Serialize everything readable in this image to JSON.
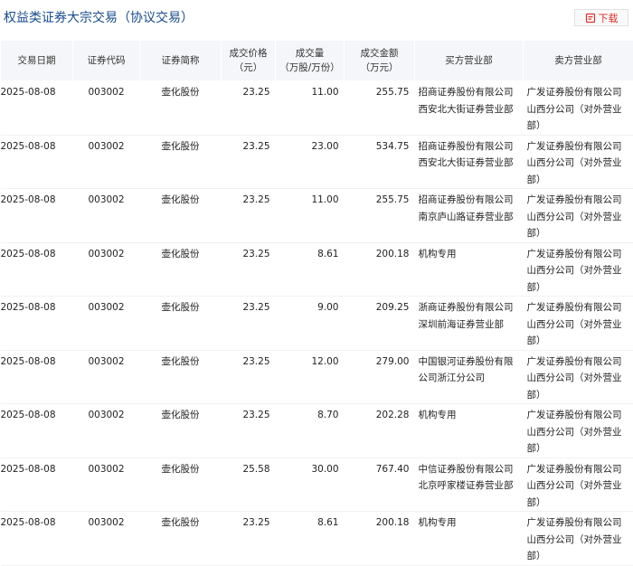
{
  "page": {
    "title": "权益类证券大宗交易（协议交易）",
    "download_label": "下载",
    "accent_color": "#d9302b",
    "title_color": "#1a4b8c"
  },
  "table": {
    "headers": {
      "date": "交易日期",
      "code": "证券代码",
      "name": "证券简称",
      "price": "成交价格\n（元）",
      "volume": "成交量\n（万股/万份）",
      "amount": "成交金额\n（万元）",
      "buyer": "买方营业部",
      "seller": "卖方营业部"
    },
    "rows": [
      {
        "date": "2025-08-08",
        "code": "003002",
        "name": "壶化股份",
        "price": "23.25",
        "volume": "11.00",
        "amount": "255.75",
        "buyer": "招商证券股份有限公司西安北大街证券营业部",
        "seller": "广发证券股份有限公司山西分公司（对外营业部）"
      },
      {
        "date": "2025-08-08",
        "code": "003002",
        "name": "壶化股份",
        "price": "23.25",
        "volume": "23.00",
        "amount": "534.75",
        "buyer": "招商证券股份有限公司西安北大街证券营业部",
        "seller": "广发证券股份有限公司山西分公司（对外营业部）"
      },
      {
        "date": "2025-08-08",
        "code": "003002",
        "name": "壶化股份",
        "price": "23.25",
        "volume": "11.00",
        "amount": "255.75",
        "buyer": "招商证券股份有限公司南京庐山路证券营业部",
        "seller": "广发证券股份有限公司山西分公司（对外营业部）"
      },
      {
        "date": "2025-08-08",
        "code": "003002",
        "name": "壶化股份",
        "price": "23.25",
        "volume": "8.61",
        "amount": "200.18",
        "buyer": "机构专用",
        "seller": "广发证券股份有限公司山西分公司（对外营业部）"
      },
      {
        "date": "2025-08-08",
        "code": "003002",
        "name": "壶化股份",
        "price": "23.25",
        "volume": "9.00",
        "amount": "209.25",
        "buyer": "浙商证券股份有限公司深圳前海证券营业部",
        "seller": "广发证券股份有限公司山西分公司（对外营业部）"
      },
      {
        "date": "2025-08-08",
        "code": "003002",
        "name": "壶化股份",
        "price": "23.25",
        "volume": "12.00",
        "amount": "279.00",
        "buyer": "中国银河证券股份有限公司浙江分公司",
        "seller": "广发证券股份有限公司山西分公司（对外营业部）"
      },
      {
        "date": "2025-08-08",
        "code": "003002",
        "name": "壶化股份",
        "price": "23.25",
        "volume": "8.70",
        "amount": "202.28",
        "buyer": "机构专用",
        "seller": "广发证券股份有限公司山西分公司（对外营业部）"
      },
      {
        "date": "2025-08-08",
        "code": "003002",
        "name": "壶化股份",
        "price": "25.58",
        "volume": "30.00",
        "amount": "767.40",
        "buyer": "中信证券股份有限公司北京呼家楼证券营业部",
        "seller": "广发证券股份有限公司山西分公司（对外营业部）"
      },
      {
        "date": "2025-08-08",
        "code": "003002",
        "name": "壶化股份",
        "price": "23.25",
        "volume": "8.61",
        "amount": "200.18",
        "buyer": "机构专用",
        "seller": "广发证券股份有限公司山西分公司（对外营业部）"
      }
    ]
  }
}
